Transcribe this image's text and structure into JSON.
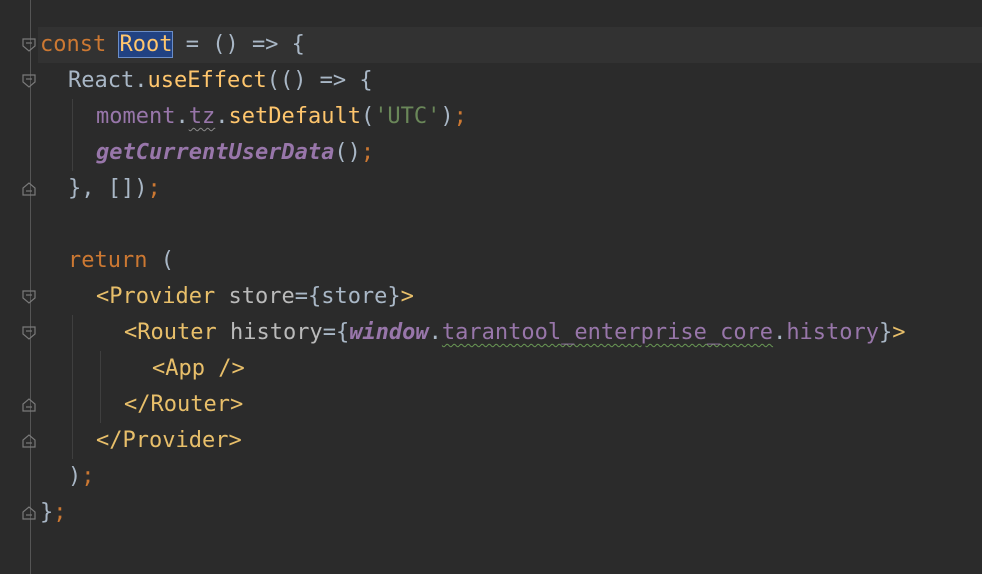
{
  "editor": {
    "language": "JavaScript (JSX)",
    "lines": {
      "l1": {
        "kw": "const",
        "name": "Root",
        "rest": " = () => {"
      },
      "l2": {
        "obj": "React",
        "dot": ".",
        "fn": "useEffect",
        "rest": "(() => {"
      },
      "l3": {
        "obj": "moment",
        "dot1": ".",
        "prop": "tz",
        "dot2": ".",
        "fn": "setDefault",
        "open": "(",
        "str": "'UTC'",
        "close": ")",
        "semi": ";"
      },
      "l4": {
        "fn": "getCurrentUserData",
        "parens": "()",
        "semi": ";"
      },
      "l5": {
        "text": "}, [])",
        "semi": ";"
      },
      "l7": {
        "kw": "return",
        "rest": " ("
      },
      "l8": {
        "open": "<Provider",
        "attr": " store",
        "eq": "=",
        "val": "{store}",
        "close": ">"
      },
      "l9": {
        "open": "<Router",
        "attr": " history",
        "eq": "=",
        "brace_open": "{",
        "obj": "window",
        "dot1": ".",
        "prop1": "tarantool_enterprise_core",
        "dot2": ".",
        "prop2": "history",
        "brace_close": "}",
        "close": ">"
      },
      "l10": {
        "tag": "<App />"
      },
      "l11": {
        "tag": "</Router>"
      },
      "l12": {
        "tag": "</Provider>"
      },
      "l13": {
        "text": ")",
        "semi": ";"
      },
      "l14": {
        "text": "}",
        "semi": ";"
      }
    }
  },
  "colors": {
    "background": "#2b2b2b",
    "keyword": "#cc7832",
    "function": "#ffc66d",
    "property": "#9876aa",
    "string": "#6a8759",
    "tag": "#e8bf6a",
    "default": "#a9b7c6",
    "selection": "#214283"
  }
}
